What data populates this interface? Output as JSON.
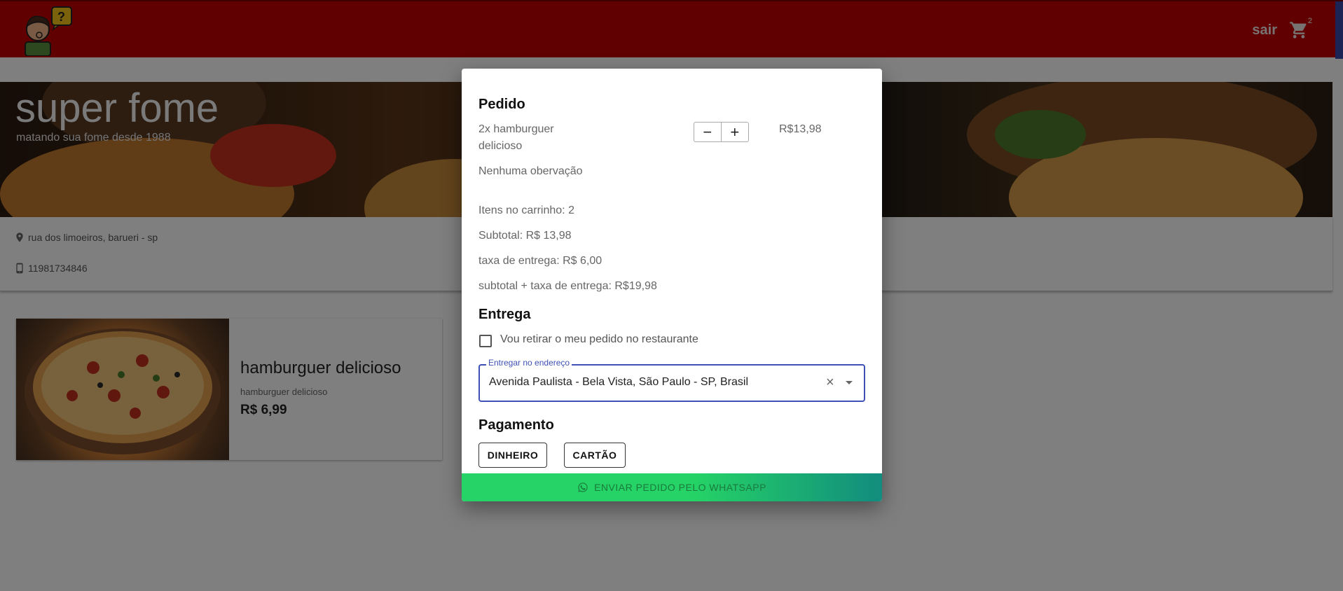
{
  "appbar": {
    "logout_label": "sair",
    "cart_count": "2",
    "brand_color": "#c00000"
  },
  "hero": {
    "title": "super fome",
    "subtitle": "matando sua fome desde 1988"
  },
  "restaurant": {
    "address": "rua dos limoeiros, barueri - sp",
    "phone": "11981734846"
  },
  "product": {
    "title": "hamburguer delicioso",
    "description": "hamburguer delicioso",
    "price": "R$ 6,99"
  },
  "order_modal": {
    "order_heading": "Pedido",
    "item": {
      "name_line1": "2x hamburguer",
      "name_line2": "delicioso",
      "decrement_symbol": "−",
      "increment_symbol": "+",
      "price": "R$13,98",
      "note": "Nenhuma obervação"
    },
    "summary": {
      "items_in_cart": "Itens no carrinho: 2",
      "subtotal": "Subtotal: R$ 13,98",
      "delivery_fee": "taxa de entrega: R$ 6,00",
      "total": "subtotal + taxa de entrega: R$19,98"
    },
    "delivery_heading": "Entrega",
    "pickup_checkbox_label": "Vou retirar o meu pedido no restaurante",
    "address_field": {
      "label": "Entregar no endereço",
      "value": "Avenida Paulista - Bela Vista, São Paulo - SP, Brasil"
    },
    "payment_heading": "Pagamento",
    "payment_options": [
      "DINHEIRO",
      "CARTÃO"
    ],
    "send_button_label": "ENVIAR PEDIDO PELO WHATSAPP",
    "send_button_color": "#25d366"
  },
  "icons": {
    "logo": "thinking-person-question-logo",
    "cart": "cart-icon",
    "location": "location-pin-icon",
    "phone": "phone-icon",
    "whatsapp": "whatsapp-icon",
    "clear": "close-icon",
    "dropdown": "chevron-down-icon"
  }
}
